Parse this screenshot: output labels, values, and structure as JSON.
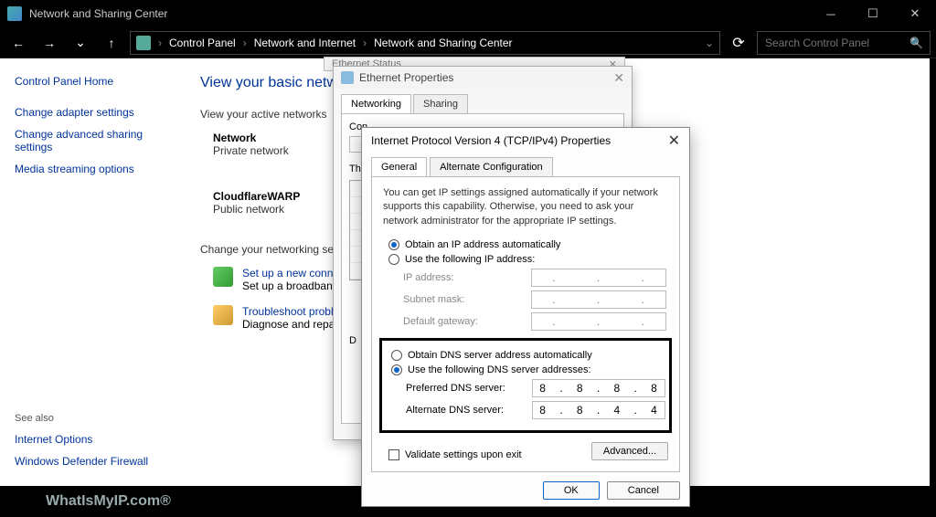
{
  "titlebar": {
    "title": "Network and Sharing Center"
  },
  "nav": {
    "crumbs": [
      "Control Panel",
      "Network and Internet",
      "Network and Sharing Center"
    ],
    "search_placeholder": "Search Control Panel"
  },
  "sidepane": {
    "home": "Control Panel Home",
    "links": [
      "Change adapter settings",
      "Change advanced sharing settings",
      "Media streaming options"
    ],
    "seealso_label": "See also",
    "seealso": [
      "Internet Options",
      "Windows Defender Firewall"
    ]
  },
  "main": {
    "heading": "View your basic network",
    "active_label": "View your active networks",
    "nets": [
      {
        "name": "Network",
        "type": "Private network"
      },
      {
        "name": "CloudflareWARP",
        "type": "Public network"
      }
    ],
    "change_label": "Change your networking settin",
    "tasks": [
      {
        "link": "Set up a new connec",
        "sub": "Set up a broadband,"
      },
      {
        "link": "Troubleshoot proble",
        "sub": "Diagnose and repair"
      }
    ]
  },
  "footer": {
    "watermark": "WhatIsMyIP.com®"
  },
  "behind1": {
    "title": "Ethernet Status"
  },
  "ethprop": {
    "title": "Ethernet Properties",
    "tabs": [
      "Networking",
      "Sharing"
    ],
    "connect_label": "Con",
    "this_label": "Th",
    "d_label": "D"
  },
  "ipv4": {
    "title": "Internet Protocol Version 4 (TCP/IPv4) Properties",
    "tabs": [
      "General",
      "Alternate Configuration"
    ],
    "desc": "You can get IP settings assigned automatically if your network supports this capability. Otherwise, you need to ask your network administrator for the appropriate IP settings.",
    "ip_auto": "Obtain an IP address automatically",
    "ip_manual": "Use the following IP address:",
    "ip_label": "IP address:",
    "mask_label": "Subnet mask:",
    "gw_label": "Default gateway:",
    "dns_auto": "Obtain DNS server address automatically",
    "dns_manual": "Use the following DNS server addresses:",
    "pref_dns_label": "Preferred DNS server:",
    "alt_dns_label": "Alternate DNS server:",
    "pref_dns": [
      "8",
      "8",
      "8",
      "8"
    ],
    "alt_dns": [
      "8",
      "8",
      "4",
      "4"
    ],
    "validate": "Validate settings upon exit",
    "advanced": "Advanced...",
    "ok": "OK",
    "cancel": "Cancel",
    "dot": "."
  }
}
